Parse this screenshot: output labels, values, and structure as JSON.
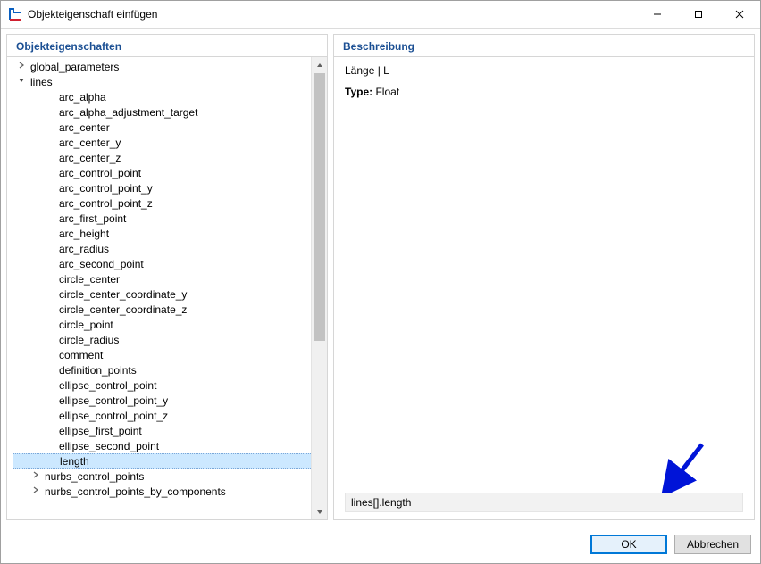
{
  "window": {
    "title": "Objekteigenschaft einfügen"
  },
  "left_panel": {
    "title": "Objekteigenschaften"
  },
  "right_panel": {
    "title": "Beschreibung",
    "desc_line": "Länge | L",
    "type_label": "Type:",
    "type_value": "Float",
    "expression": "lines[].length"
  },
  "footer": {
    "ok": "OK",
    "cancel": "Abbrechen"
  },
  "tree": [
    {
      "label": "global_parameters",
      "depth": 1,
      "arrow": "right"
    },
    {
      "label": "lines",
      "depth": 1,
      "arrow": "down"
    },
    {
      "label": "arc_alpha",
      "depth": 3
    },
    {
      "label": "arc_alpha_adjustment_target",
      "depth": 3
    },
    {
      "label": "arc_center",
      "depth": 3
    },
    {
      "label": "arc_center_y",
      "depth": 3
    },
    {
      "label": "arc_center_z",
      "depth": 3
    },
    {
      "label": "arc_control_point",
      "depth": 3
    },
    {
      "label": "arc_control_point_y",
      "depth": 3
    },
    {
      "label": "arc_control_point_z",
      "depth": 3
    },
    {
      "label": "arc_first_point",
      "depth": 3
    },
    {
      "label": "arc_height",
      "depth": 3
    },
    {
      "label": "arc_radius",
      "depth": 3
    },
    {
      "label": "arc_second_point",
      "depth": 3
    },
    {
      "label": "circle_center",
      "depth": 3
    },
    {
      "label": "circle_center_coordinate_y",
      "depth": 3
    },
    {
      "label": "circle_center_coordinate_z",
      "depth": 3
    },
    {
      "label": "circle_point",
      "depth": 3
    },
    {
      "label": "circle_radius",
      "depth": 3
    },
    {
      "label": "comment",
      "depth": 3
    },
    {
      "label": "definition_points",
      "depth": 3
    },
    {
      "label": "ellipse_control_point",
      "depth": 3
    },
    {
      "label": "ellipse_control_point_y",
      "depth": 3
    },
    {
      "label": "ellipse_control_point_z",
      "depth": 3
    },
    {
      "label": "ellipse_first_point",
      "depth": 3
    },
    {
      "label": "ellipse_second_point",
      "depth": 3
    },
    {
      "label": "length",
      "depth": 3,
      "selected": true
    },
    {
      "label": "nurbs_control_points",
      "depth": 2,
      "arrow": "right"
    },
    {
      "label": "nurbs_control_points_by_components",
      "depth": 2,
      "arrow": "right"
    }
  ]
}
